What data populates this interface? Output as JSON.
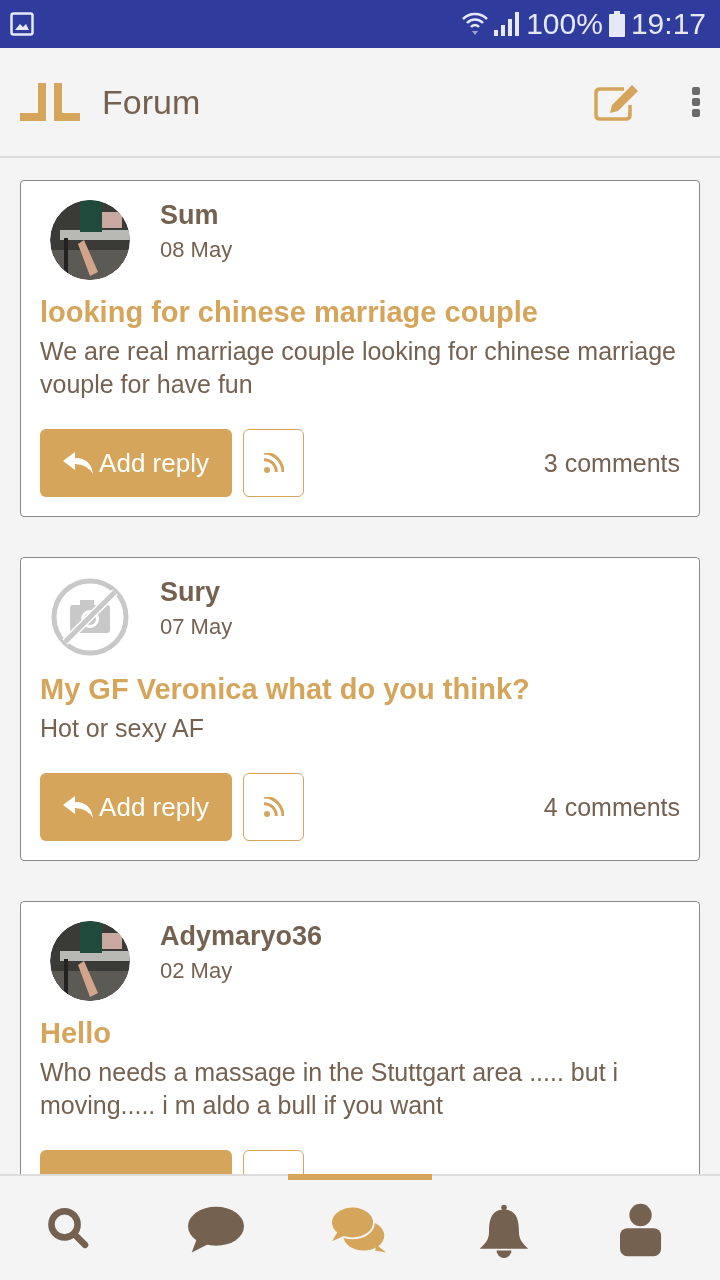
{
  "status_bar": {
    "battery": "100%",
    "time": "19:17"
  },
  "app_bar": {
    "title": "Forum"
  },
  "posts": [
    {
      "author": "Sum",
      "date": "08 May",
      "title": "looking for chinese marriage couple",
      "body": "We are real marriage couple looking for chinese marriage vouple for have fun",
      "reply_label": "Add reply",
      "comments": "3 comments"
    },
    {
      "author": "Sury",
      "date": "07 May",
      "avatar": {
        "kind": "placeholder"
      },
      "title": "My GF Veronica what do you think?",
      "body": "Hot or sexy AF",
      "reply_label": "Add reply",
      "comments": "4 comments"
    },
    {
      "author": "Adymaryo36",
      "date": "02 May",
      "title": "Hello",
      "body": "Who needs a massage in the Stuttgart area ..... but i moving..... i m aldo a bull if you want"
    }
  ],
  "bottom_nav": [
    {
      "kind": "search",
      "selected": false
    },
    {
      "kind": "chat",
      "selected": false
    },
    {
      "kind": "forum",
      "selected": true
    },
    {
      "kind": "notifications",
      "selected": false
    },
    {
      "kind": "profile",
      "selected": false
    }
  ]
}
